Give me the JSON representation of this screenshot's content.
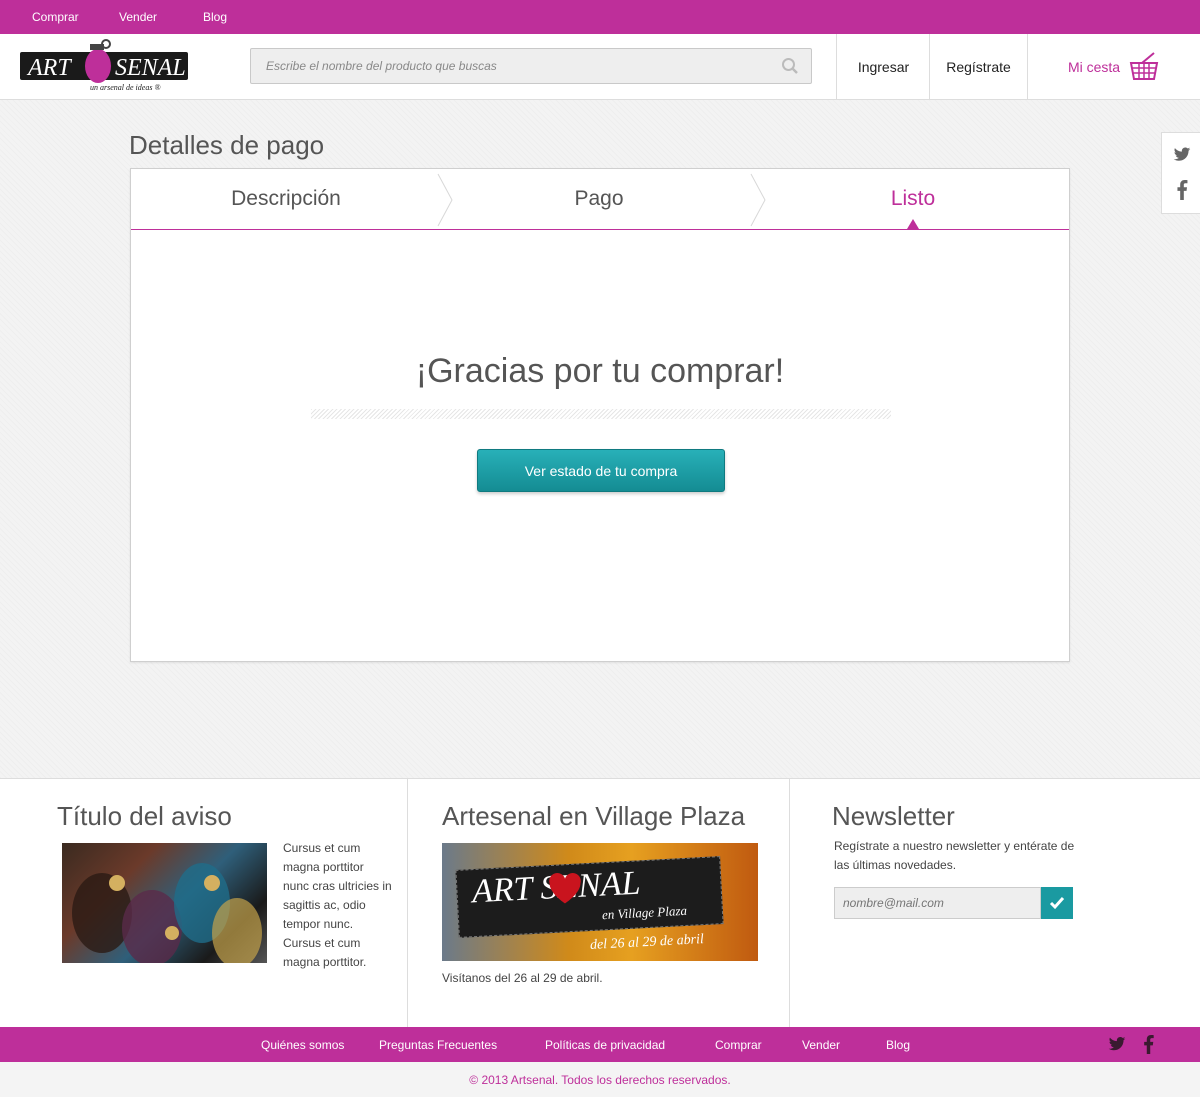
{
  "topnav": {
    "items": [
      "Comprar",
      "Vender",
      "Blog"
    ]
  },
  "brand": {
    "name": "ARTSENAL",
    "tagline": "un arsenal de ideas",
    "accent": "#be2f9a",
    "teal": "#1a9aa1"
  },
  "search": {
    "placeholder": "Escribe el nombre del producto que buscas"
  },
  "header": {
    "login_label": "Ingresar",
    "register_label": "Regístrate",
    "cart_label": "Mi cesta"
  },
  "page": {
    "title": "Detalles de pago"
  },
  "steps": [
    {
      "label": "Descripción",
      "active": false
    },
    {
      "label": "Pago",
      "active": false
    },
    {
      "label": "Listo",
      "active": true
    }
  ],
  "confirmation": {
    "message": "¡Gracias por tu comprar!",
    "button_label": "Ver estado de tu compra"
  },
  "footer": {
    "notice": {
      "title": "Título del aviso",
      "text": "Cursus et cum magna porttitor nunc cras ultricies in sagittis ac, odio tempor nunc. Cursus et cum magna porttitor."
    },
    "event": {
      "title": "Artesenal en Village Plaza",
      "banner_brand": "ART SENAL",
      "banner_sub": "en Village Plaza",
      "banner_dates": "del 26 al 29 de abril",
      "caption": "Visítanos del 26 al 29 de abril."
    },
    "newsletter": {
      "title": "Newsletter",
      "text": "Regístrate a nuestro newsletter y entérate de las últimas novedades.",
      "placeholder": "nombre@mail.com"
    }
  },
  "bottomnav": {
    "items": [
      "Quiénes somos",
      "Preguntas Frecuentes",
      "Políticas de privacidad",
      "Comprar",
      "Vender",
      "Blog"
    ]
  },
  "copyright": "© 2013 Artsenal. Todos los derechos reservados."
}
